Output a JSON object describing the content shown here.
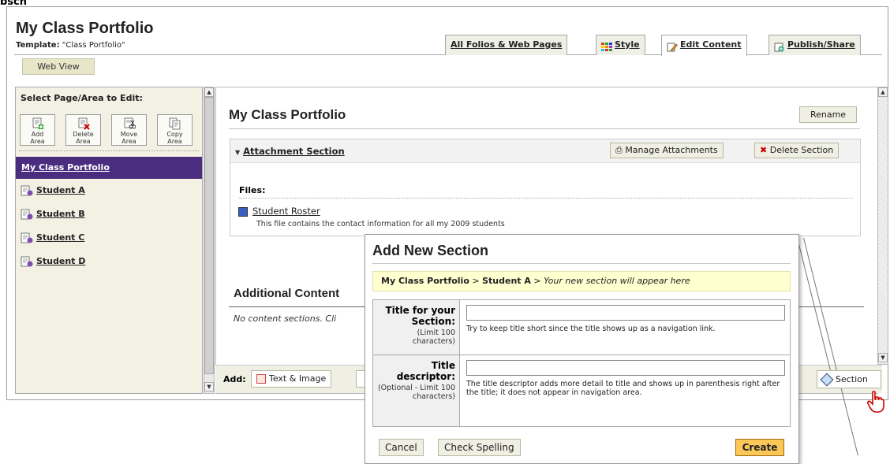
{
  "page": {
    "cut_text": "bsch",
    "title": "My Class Portfolio",
    "template_label": "Template:",
    "template_value": "\"Class Portfolio\"",
    "web_view_label": "Web View"
  },
  "tabs": [
    {
      "label": "All Folios & Web Pages",
      "icon": ""
    },
    {
      "label": "Style",
      "icon": "style-grid-icon"
    },
    {
      "label": "Edit Content",
      "icon": "edit-pencil-icon"
    },
    {
      "label": "Publish/Share",
      "icon": "publish-icon"
    }
  ],
  "sidebar": {
    "heading": "Select Page/Area to Edit:",
    "toolbar": [
      {
        "label1": "Add",
        "label2": "Area",
        "icon": "add-area-icon"
      },
      {
        "label1": "Delete",
        "label2": "Area",
        "icon": "delete-area-icon"
      },
      {
        "label1": "Move",
        "label2": "Area",
        "icon": "move-area-icon"
      },
      {
        "label1": "Copy",
        "label2": "Area",
        "icon": "copy-area-icon"
      }
    ],
    "selected": "My Class Portfolio",
    "items": [
      "Student A",
      "Student B",
      "Student C",
      "Student D"
    ]
  },
  "main": {
    "title": "My Class Portfolio",
    "rename_label": "Rename",
    "section_title": "Attachment Section",
    "manage_label": "Manage Attachments",
    "delete_section_label": "Delete Section",
    "files_label": "Files:",
    "file_name": "Student Roster",
    "file_desc": "This file contains the contact information for all my 2009 students",
    "additional_title": "Additional Content",
    "no_content_text": "No content sections. Cli",
    "add_label": "Add:",
    "add_text_image": "Text & Image",
    "section_button": "Section"
  },
  "modal": {
    "title": "Add New Section",
    "crumb_parent": "My Class Portfolio",
    "crumb_sep": ">",
    "crumb_child": "Student A",
    "crumb_note": "Your new section will appear here",
    "field1_label": "Title for your Section:",
    "field1_limit": "(Limit 100 characters)",
    "field1_value": "",
    "field1_help": "Try to keep title short since the title shows up as a navigation link.",
    "field2_label": "Title descriptor:",
    "field2_limit": "(Optional - Limit 100 characters)",
    "field2_value": "",
    "field2_help": "The title descriptor adds more detail to title and shows up in parenthesis right after the title; it does not appear in navigation area.",
    "cancel_label": "Cancel",
    "spelling_label": "Check Spelling",
    "create_label": "Create"
  },
  "colors": {
    "selected_nav": "#4b2d7f",
    "panel_bg": "#f2f1e3",
    "crumb_bg": "#ffffd0",
    "create_bg": "#fbc858"
  }
}
